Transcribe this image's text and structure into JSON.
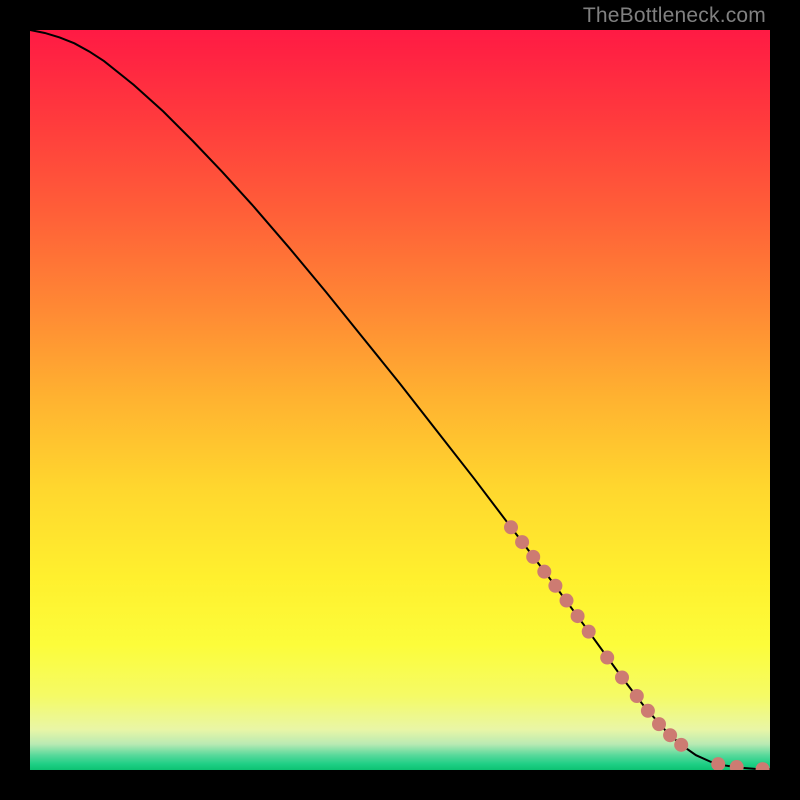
{
  "watermark": "TheBottleneck.com",
  "colors": {
    "curve": "#000000",
    "marker_fill": "#cd7b72",
    "marker_stroke": "#cd7b72",
    "frame": "#000000",
    "gradient_stops": [
      {
        "offset": 0.0,
        "color": "#ff1a44"
      },
      {
        "offset": 0.12,
        "color": "#ff3a3d"
      },
      {
        "offset": 0.25,
        "color": "#ff6038"
      },
      {
        "offset": 0.38,
        "color": "#ff8a34"
      },
      {
        "offset": 0.5,
        "color": "#ffb330"
      },
      {
        "offset": 0.62,
        "color": "#ffd72e"
      },
      {
        "offset": 0.74,
        "color": "#fff02e"
      },
      {
        "offset": 0.83,
        "color": "#fcfc3a"
      },
      {
        "offset": 0.9,
        "color": "#f5fb66"
      },
      {
        "offset": 0.945,
        "color": "#e9f6a6"
      },
      {
        "offset": 0.965,
        "color": "#b9eab3"
      },
      {
        "offset": 0.98,
        "color": "#58d99b"
      },
      {
        "offset": 0.992,
        "color": "#1ecf85"
      },
      {
        "offset": 1.0,
        "color": "#0cc272"
      }
    ]
  },
  "chart_data": {
    "type": "line",
    "title": "",
    "xlabel": "",
    "ylabel": "",
    "xlim": [
      0,
      100
    ],
    "ylim": [
      0,
      100
    ],
    "series": [
      {
        "name": "curve",
        "x": [
          0,
          2,
          4,
          6,
          8,
          10,
          14,
          18,
          22,
          26,
          30,
          35,
          40,
          45,
          50,
          55,
          60,
          65,
          70,
          75,
          80,
          83,
          86,
          88,
          90,
          92,
          94,
          96,
          98,
          100
        ],
        "y": [
          100,
          99.6,
          99.0,
          98.2,
          97.1,
          95.8,
          92.6,
          89.0,
          85.0,
          80.8,
          76.4,
          70.6,
          64.6,
          58.4,
          52.2,
          45.8,
          39.4,
          32.8,
          26.2,
          19.4,
          12.5,
          8.6,
          5.2,
          3.4,
          2.0,
          1.1,
          0.6,
          0.3,
          0.15,
          0.1
        ]
      }
    ],
    "markers": {
      "name": "points",
      "x": [
        65,
        66.5,
        68,
        69.5,
        71,
        72.5,
        74,
        75.5,
        78,
        80,
        82,
        83.5,
        85,
        86.5,
        88,
        93,
        95.5,
        99
      ],
      "y": [
        32.8,
        30.8,
        28.8,
        26.8,
        24.9,
        22.9,
        20.8,
        18.7,
        15.2,
        12.5,
        10.0,
        8.0,
        6.2,
        4.7,
        3.4,
        0.8,
        0.4,
        0.12
      ],
      "r": 7
    }
  }
}
